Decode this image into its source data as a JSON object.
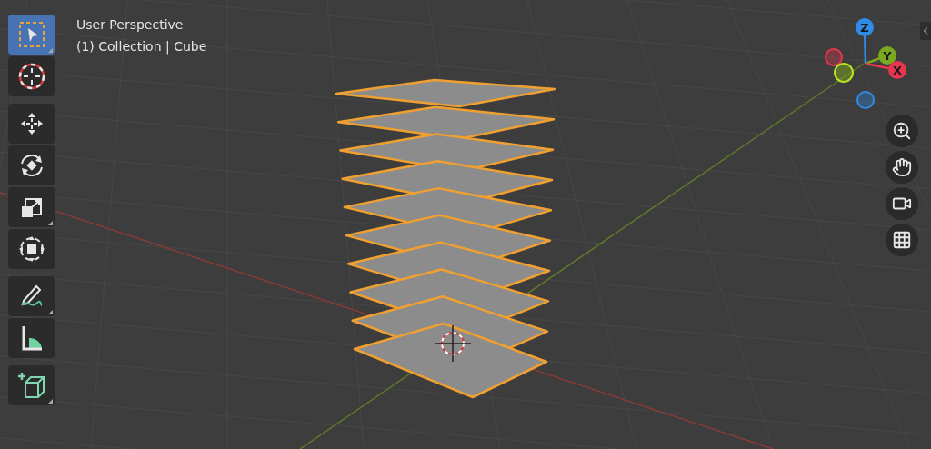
{
  "viewport": {
    "view_name": "User Perspective",
    "context": "(1) Collection | Cube"
  },
  "toolbar": {
    "groups": [
      {
        "tools": [
          {
            "kind": "select_box",
            "selected": true,
            "submenu": true
          },
          {
            "kind": "cursor",
            "selected": false,
            "submenu": false
          }
        ]
      },
      {
        "tools": [
          {
            "kind": "move",
            "selected": false,
            "submenu": false
          },
          {
            "kind": "rotate",
            "selected": false,
            "submenu": false
          },
          {
            "kind": "scale",
            "selected": false,
            "submenu": true
          },
          {
            "kind": "transform",
            "selected": false,
            "submenu": false
          }
        ]
      },
      {
        "tools": [
          {
            "kind": "annotate",
            "selected": false,
            "submenu": true
          },
          {
            "kind": "measure",
            "selected": false,
            "submenu": false
          }
        ]
      },
      {
        "tools": [
          {
            "kind": "add_cube",
            "selected": false,
            "submenu": true
          }
        ]
      }
    ]
  },
  "gizmo": {
    "axes": [
      {
        "label": "Z",
        "color": "#2e8ce6"
      },
      {
        "label": "Y",
        "color": "#7ba81e"
      },
      {
        "label": "X",
        "color": "#e8364f"
      }
    ]
  },
  "navigation": {
    "buttons": [
      {
        "kind": "zoom"
      },
      {
        "kind": "pan"
      },
      {
        "kind": "camera"
      },
      {
        "kind": "ortho"
      }
    ]
  }
}
